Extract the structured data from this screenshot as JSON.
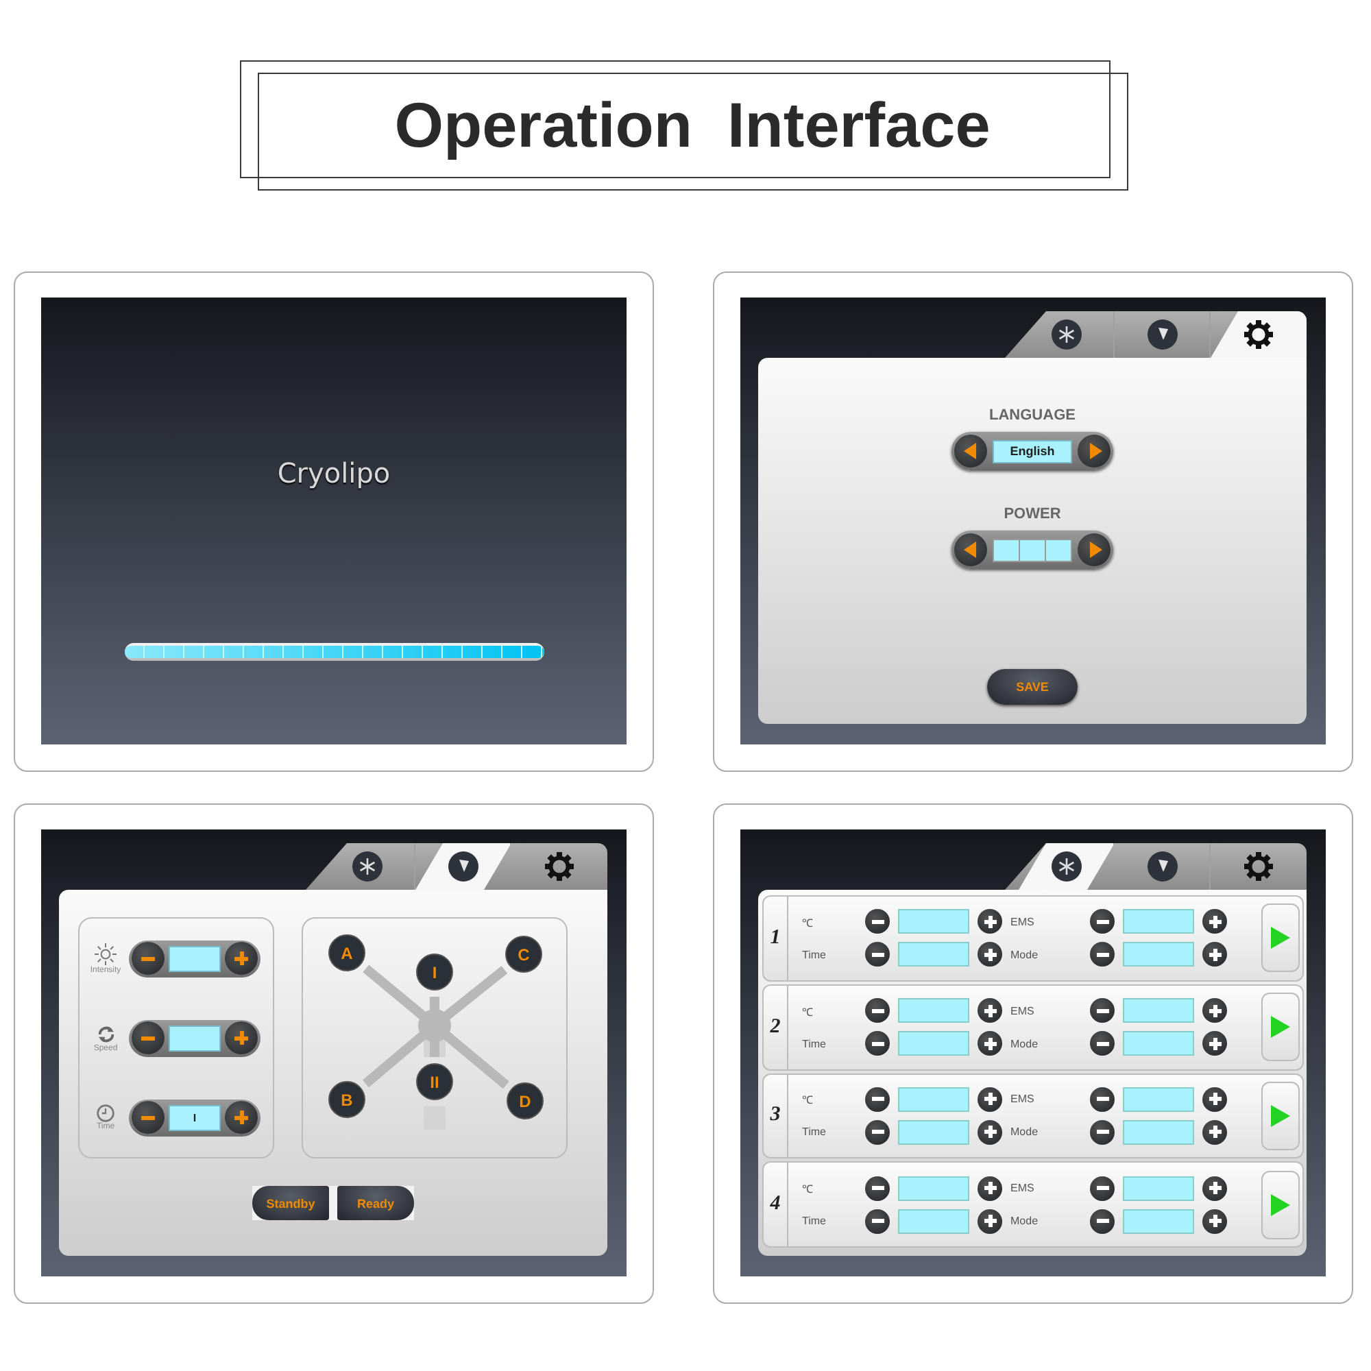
{
  "title": "Operation  Interface",
  "screens": [
    {
      "kind": "splash",
      "brand": "Cryolipo",
      "progress": {
        "level": 1
      }
    },
    {
      "kind": "settings",
      "tabs": [
        {
          "selected": false
        },
        {
          "selected": false
        },
        {
          "selected": true
        }
      ],
      "language": {
        "label": "LANGUAGE",
        "value": "English"
      },
      "power": {
        "label": "POWER"
      },
      "save": "SAVE"
    },
    {
      "kind": "handpiece",
      "tabs": [
        {
          "selected": false
        },
        {
          "selected": true
        },
        {
          "selected": false
        }
      ],
      "controls": [
        {
          "label": "Intensity"
        },
        {
          "label": "Speed"
        },
        {
          "label": "Time",
          "value": "I"
        }
      ],
      "points": [
        "A",
        "I",
        "C",
        "B",
        "II",
        "D"
      ],
      "modes": [
        "Standby",
        "Ready"
      ]
    },
    {
      "kind": "channels",
      "tabs": [
        {
          "selected": true
        },
        {
          "selected": false
        },
        {
          "selected": false
        }
      ],
      "channels": [
        {
          "number": "1",
          "labels": [
            "℃",
            "EMS",
            "Time",
            "Mode"
          ]
        },
        {
          "number": "2",
          "labels": [
            "℃",
            "EMS",
            "Time",
            "Mode"
          ]
        },
        {
          "number": "3",
          "labels": [
            "℃",
            "EMS",
            "Time",
            "Mode"
          ]
        },
        {
          "number": "4",
          "labels": [
            "℃",
            "EMS",
            "Time",
            "Mode"
          ]
        }
      ]
    }
  ]
}
